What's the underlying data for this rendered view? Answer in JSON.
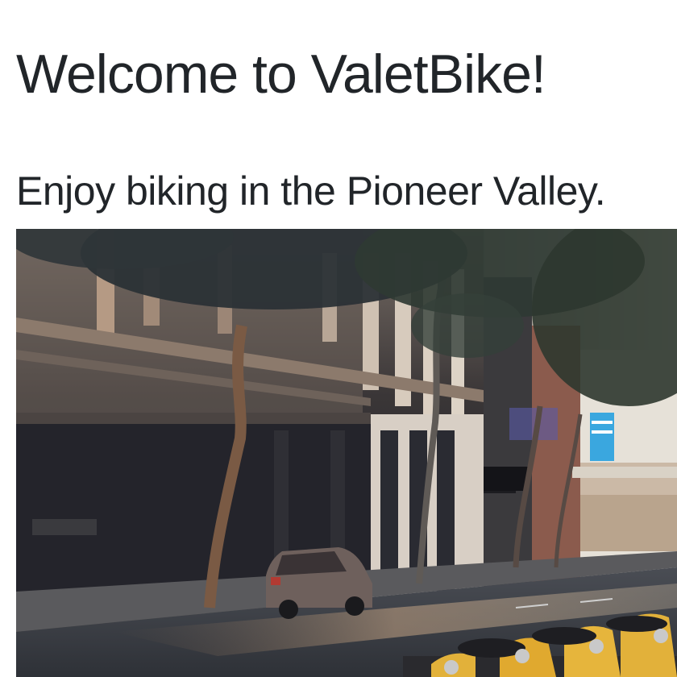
{
  "page": {
    "heading": "Welcome to ValetBike!",
    "subheading": "Enjoy biking in the Pioneer Valley."
  },
  "hero_image": {
    "depicts": "photo-street-bike-share",
    "colors": {
      "building_dark": "#2b2c33",
      "building_stone": "#8a7f74",
      "sky": "#e8e4dc",
      "tree": "#2f3a33",
      "road": "#3b3f46",
      "sidewalk": "#5a5a5d",
      "car": "#7a6a66",
      "bike_yellow": "#e2b13a",
      "sign_blue": "#3aa7df"
    }
  }
}
